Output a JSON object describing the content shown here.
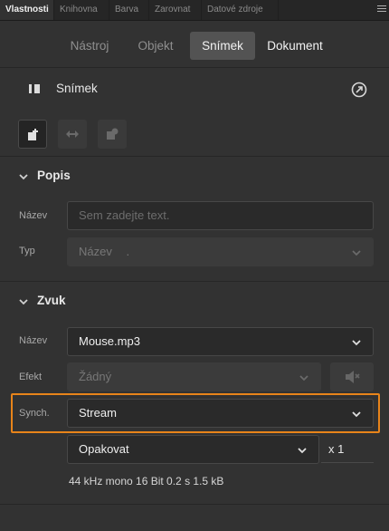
{
  "panel_tabs": [
    "Vlastnosti",
    "Knihovna",
    "Barva",
    "Zarovnat",
    "Datové zdroje"
  ],
  "mode_tabs": [
    "Nástroj",
    "Objekt",
    "Snímek",
    "Dokument"
  ],
  "header": {
    "title": "Snímek",
    "title_icon": "frame-icon",
    "action_icon": "external-link-icon"
  },
  "toolbar": {
    "icons": [
      "add-frame-icon",
      "tween-icon",
      "frame-effect-icon"
    ]
  },
  "popis": {
    "heading": "Popis",
    "name_label": "Název",
    "name_placeholder": "Sem zadejte text.",
    "type_label": "Typ",
    "type_value": "Název",
    "type_suffix": "."
  },
  "zvuk": {
    "heading": "Zvuk",
    "name_label": "Název",
    "name_value": "Mouse.mp3",
    "effect_label": "Efekt",
    "effect_value": "Žádný",
    "sync_label": "Synch.",
    "sync_value": "Stream",
    "loop_value": "Opakovat",
    "loop_count": "x 1",
    "info": "44 kHz mono 16 Bit 0.2 s 1.5 kB"
  },
  "colors": {
    "highlight": "#e8841a",
    "active_tab": "#535353",
    "background": "#323232"
  }
}
